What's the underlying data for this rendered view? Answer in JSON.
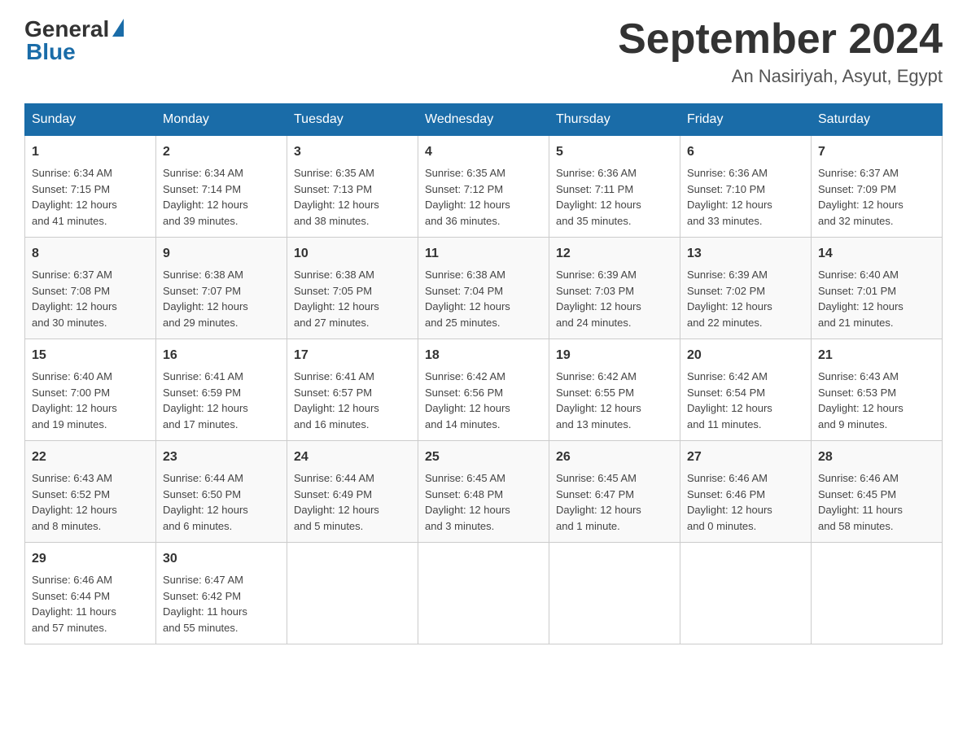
{
  "header": {
    "logo_text": "General",
    "logo_blue": "Blue",
    "title": "September 2024",
    "location": "An Nasiriyah, Asyut, Egypt"
  },
  "days_of_week": [
    "Sunday",
    "Monday",
    "Tuesday",
    "Wednesday",
    "Thursday",
    "Friday",
    "Saturday"
  ],
  "weeks": [
    [
      {
        "day": "1",
        "sunrise": "6:34 AM",
        "sunset": "7:15 PM",
        "daylight": "12 hours and 41 minutes."
      },
      {
        "day": "2",
        "sunrise": "6:34 AM",
        "sunset": "7:14 PM",
        "daylight": "12 hours and 39 minutes."
      },
      {
        "day": "3",
        "sunrise": "6:35 AM",
        "sunset": "7:13 PM",
        "daylight": "12 hours and 38 minutes."
      },
      {
        "day": "4",
        "sunrise": "6:35 AM",
        "sunset": "7:12 PM",
        "daylight": "12 hours and 36 minutes."
      },
      {
        "day": "5",
        "sunrise": "6:36 AM",
        "sunset": "7:11 PM",
        "daylight": "12 hours and 35 minutes."
      },
      {
        "day": "6",
        "sunrise": "6:36 AM",
        "sunset": "7:10 PM",
        "daylight": "12 hours and 33 minutes."
      },
      {
        "day": "7",
        "sunrise": "6:37 AM",
        "sunset": "7:09 PM",
        "daylight": "12 hours and 32 minutes."
      }
    ],
    [
      {
        "day": "8",
        "sunrise": "6:37 AM",
        "sunset": "7:08 PM",
        "daylight": "12 hours and 30 minutes."
      },
      {
        "day": "9",
        "sunrise": "6:38 AM",
        "sunset": "7:07 PM",
        "daylight": "12 hours and 29 minutes."
      },
      {
        "day": "10",
        "sunrise": "6:38 AM",
        "sunset": "7:05 PM",
        "daylight": "12 hours and 27 minutes."
      },
      {
        "day": "11",
        "sunrise": "6:38 AM",
        "sunset": "7:04 PM",
        "daylight": "12 hours and 25 minutes."
      },
      {
        "day": "12",
        "sunrise": "6:39 AM",
        "sunset": "7:03 PM",
        "daylight": "12 hours and 24 minutes."
      },
      {
        "day": "13",
        "sunrise": "6:39 AM",
        "sunset": "7:02 PM",
        "daylight": "12 hours and 22 minutes."
      },
      {
        "day": "14",
        "sunrise": "6:40 AM",
        "sunset": "7:01 PM",
        "daylight": "12 hours and 21 minutes."
      }
    ],
    [
      {
        "day": "15",
        "sunrise": "6:40 AM",
        "sunset": "7:00 PM",
        "daylight": "12 hours and 19 minutes."
      },
      {
        "day": "16",
        "sunrise": "6:41 AM",
        "sunset": "6:59 PM",
        "daylight": "12 hours and 17 minutes."
      },
      {
        "day": "17",
        "sunrise": "6:41 AM",
        "sunset": "6:57 PM",
        "daylight": "12 hours and 16 minutes."
      },
      {
        "day": "18",
        "sunrise": "6:42 AM",
        "sunset": "6:56 PM",
        "daylight": "12 hours and 14 minutes."
      },
      {
        "day": "19",
        "sunrise": "6:42 AM",
        "sunset": "6:55 PM",
        "daylight": "12 hours and 13 minutes."
      },
      {
        "day": "20",
        "sunrise": "6:42 AM",
        "sunset": "6:54 PM",
        "daylight": "12 hours and 11 minutes."
      },
      {
        "day": "21",
        "sunrise": "6:43 AM",
        "sunset": "6:53 PM",
        "daylight": "12 hours and 9 minutes."
      }
    ],
    [
      {
        "day": "22",
        "sunrise": "6:43 AM",
        "sunset": "6:52 PM",
        "daylight": "12 hours and 8 minutes."
      },
      {
        "day": "23",
        "sunrise": "6:44 AM",
        "sunset": "6:50 PM",
        "daylight": "12 hours and 6 minutes."
      },
      {
        "day": "24",
        "sunrise": "6:44 AM",
        "sunset": "6:49 PM",
        "daylight": "12 hours and 5 minutes."
      },
      {
        "day": "25",
        "sunrise": "6:45 AM",
        "sunset": "6:48 PM",
        "daylight": "12 hours and 3 minutes."
      },
      {
        "day": "26",
        "sunrise": "6:45 AM",
        "sunset": "6:47 PM",
        "daylight": "12 hours and 1 minute."
      },
      {
        "day": "27",
        "sunrise": "6:46 AM",
        "sunset": "6:46 PM",
        "daylight": "12 hours and 0 minutes."
      },
      {
        "day": "28",
        "sunrise": "6:46 AM",
        "sunset": "6:45 PM",
        "daylight": "11 hours and 58 minutes."
      }
    ],
    [
      {
        "day": "29",
        "sunrise": "6:46 AM",
        "sunset": "6:44 PM",
        "daylight": "11 hours and 57 minutes."
      },
      {
        "day": "30",
        "sunrise": "6:47 AM",
        "sunset": "6:42 PM",
        "daylight": "11 hours and 55 minutes."
      },
      null,
      null,
      null,
      null,
      null
    ]
  ],
  "labels": {
    "sunrise": "Sunrise:",
    "sunset": "Sunset:",
    "daylight": "Daylight:"
  }
}
